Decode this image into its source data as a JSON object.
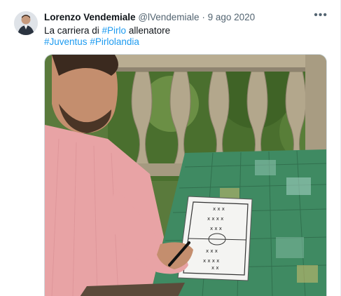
{
  "tweet": {
    "author_name": "Lorenzo Vendemiale",
    "handle": "@lVendemiale",
    "separator": "·",
    "date": "9 ago 2020",
    "more_label": "•••",
    "text_before": "La carriera di ",
    "mention_tag": "#Pirlo",
    "text_after": " allenatore",
    "hashtags": [
      "#Juventus",
      "#Pirlolandia"
    ]
  },
  "media": {
    "icon": "photo",
    "colors": {
      "table_green": "#3f8a62",
      "shirt_pink": "#e8a3a5",
      "stone": "#b9ad92",
      "foliage": "#4a6f2e"
    }
  },
  "colors": {
    "link": "#1d9bf0",
    "text": "#0f1419",
    "muted": "#536471"
  }
}
